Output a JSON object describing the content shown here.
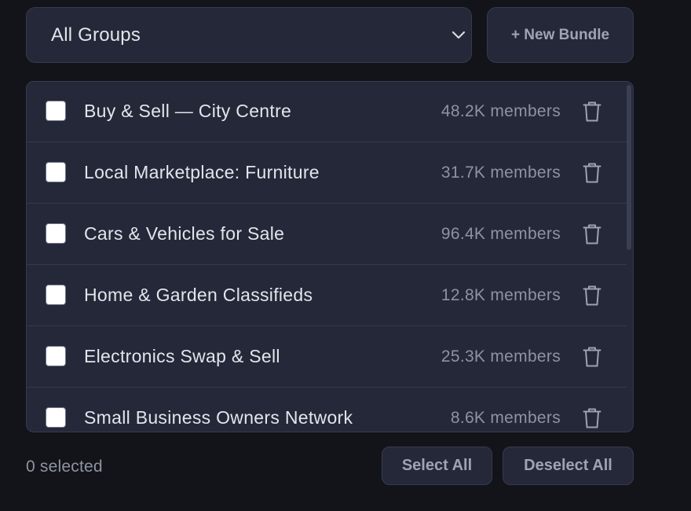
{
  "group_filter": {
    "selected": "All Groups",
    "icon": "chevron-down-icon"
  },
  "new_bundle_label": "+ New Bundle",
  "groups": [
    {
      "name": "Buy & Sell — City Centre",
      "members": "48.2K members",
      "checked": false
    },
    {
      "name": "Local Marketplace: Furniture",
      "members": "31.7K members",
      "checked": false
    },
    {
      "name": "Cars & Vehicles for Sale",
      "members": "96.4K members",
      "checked": false
    },
    {
      "name": "Home & Garden Classifieds",
      "members": "12.8K members",
      "checked": false
    },
    {
      "name": "Electronics Swap & Sell",
      "members": "25.3K members",
      "checked": false
    },
    {
      "name": "Small Business Owners Network",
      "members": "8.6K members",
      "checked": false
    }
  ],
  "footer": {
    "selected_count": "0 selected",
    "select_all_label": "Select All",
    "deselect_all_label": "Deselect All"
  },
  "colors": {
    "background": "#131419",
    "panel": "#242838",
    "border": "#363b4f",
    "text_primary": "#e3e5ec",
    "text_muted": "#8e93a4"
  }
}
